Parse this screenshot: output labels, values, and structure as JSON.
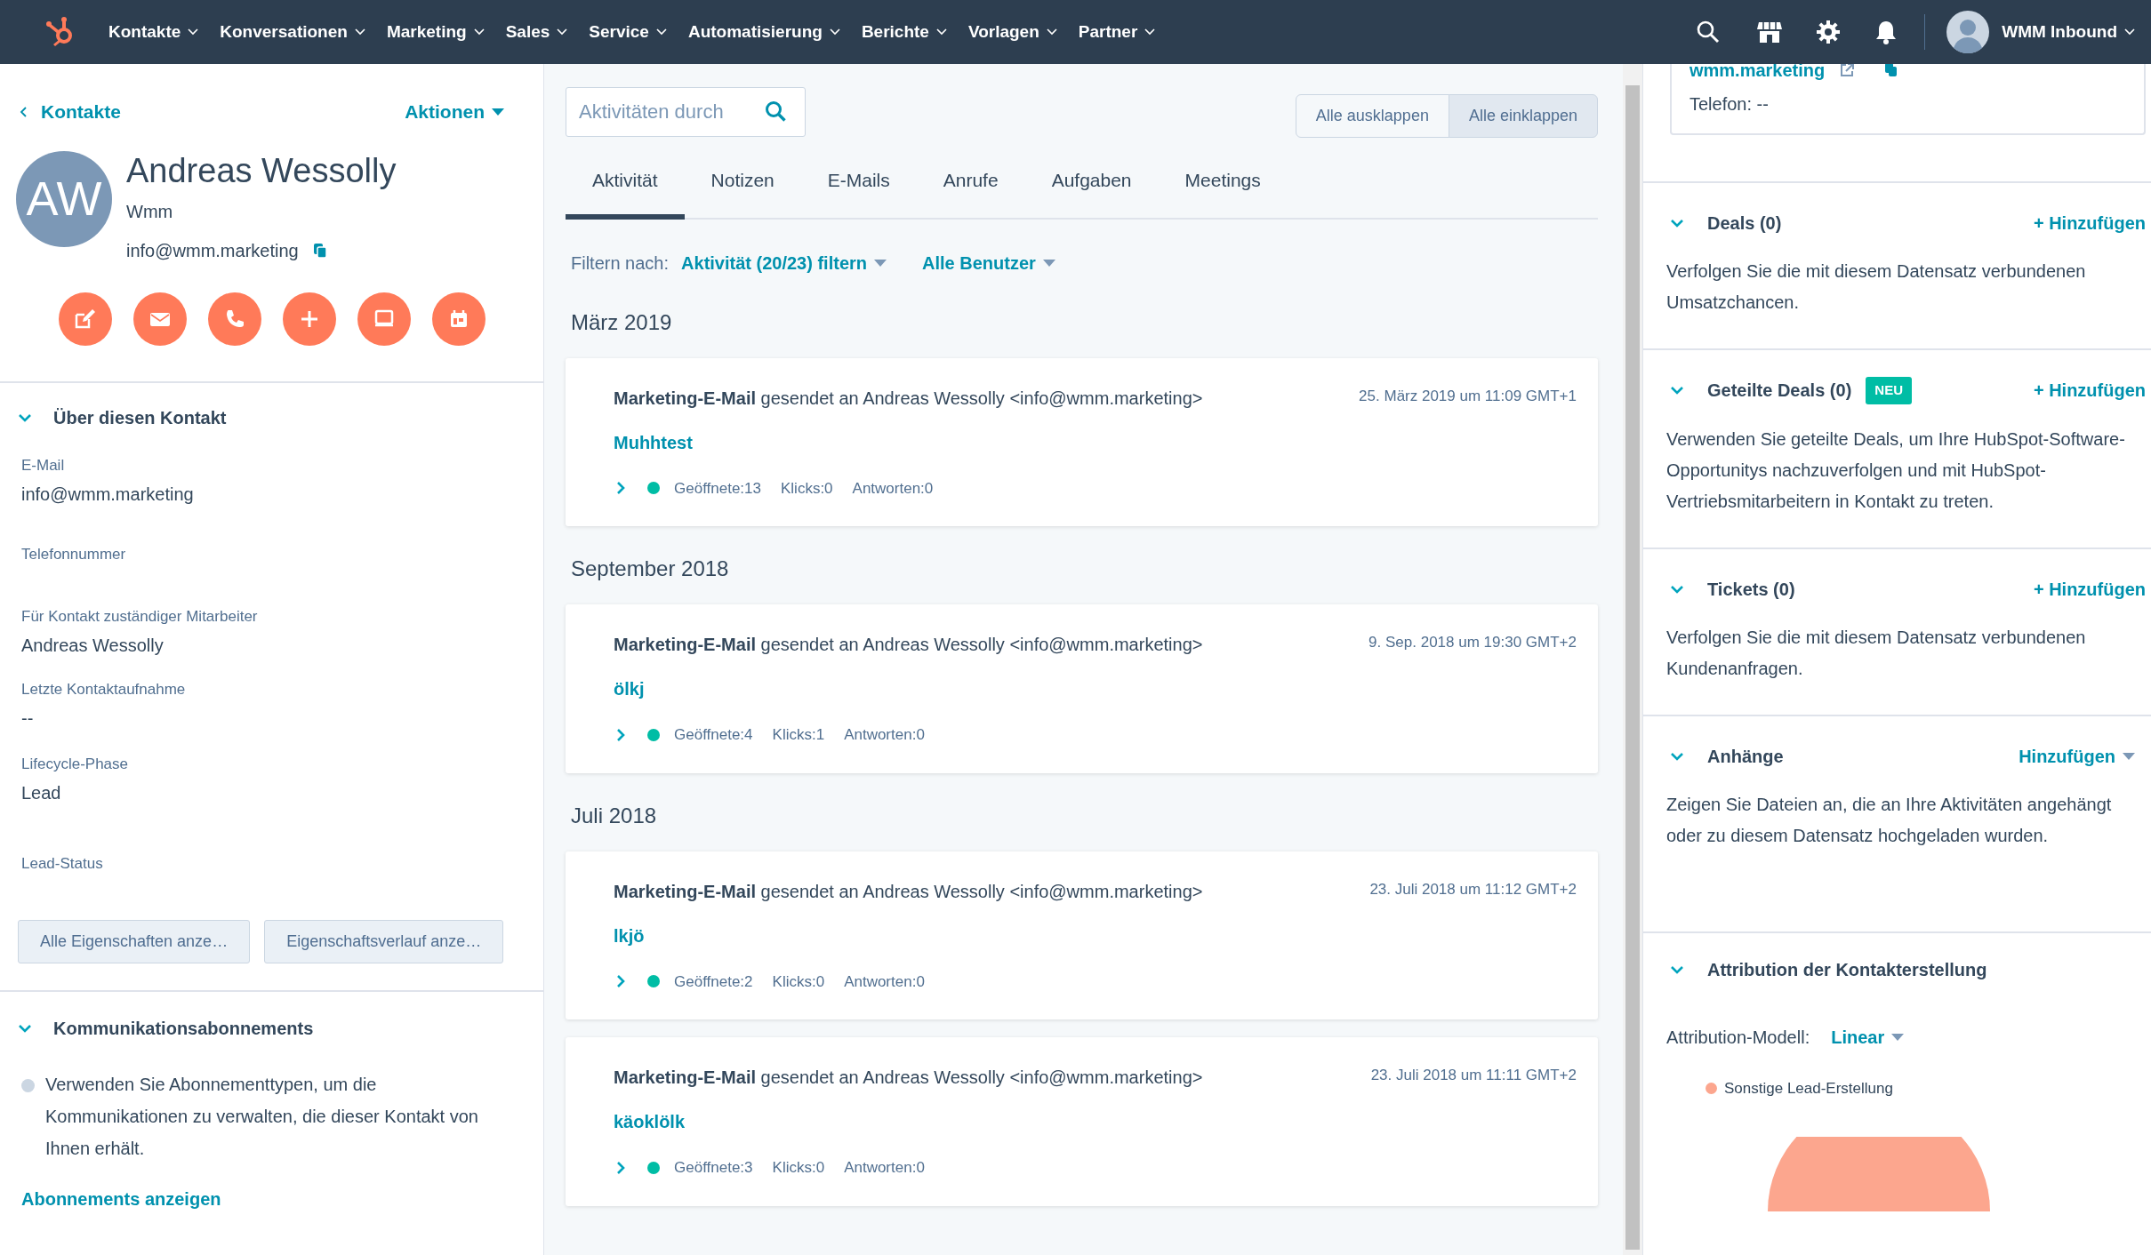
{
  "nav": {
    "items": [
      {
        "label": "Kontakte"
      },
      {
        "label": "Konversationen"
      },
      {
        "label": "Marketing"
      },
      {
        "label": "Sales"
      },
      {
        "label": "Service"
      },
      {
        "label": "Automatisierung"
      },
      {
        "label": "Berichte"
      },
      {
        "label": "Vorlagen"
      },
      {
        "label": "Partner"
      }
    ],
    "account": "WMM Inbound"
  },
  "contact": {
    "back": "Kontakte",
    "actions": "Aktionen",
    "initials": "AW",
    "name": "Andreas Wessolly",
    "company": "Wmm",
    "email": "info@wmm.marketing"
  },
  "about": {
    "title": "Über diesen Kontakt",
    "expanded": true,
    "fields": [
      {
        "label": "E-Mail",
        "value": "info@wmm.marketing"
      },
      {
        "label": "Telefonnummer"
      },
      {
        "label": "Für Kontakt zuständiger Mitarbeiter",
        "value": "Andreas Wessolly"
      },
      {
        "label": "Letzte Kontaktaufnahme",
        "value": "--"
      },
      {
        "label": "Lifecycle-Phase",
        "value": "Lead"
      },
      {
        "label": "Lead-Status"
      }
    ],
    "buttons": [
      "Alle Eigenschaften anze…",
      "Eigenschaftsverlauf anze…"
    ]
  },
  "subscriptions": {
    "title": "Kommunikationsabonnements",
    "expanded": true,
    "text": "Verwenden Sie Abonnementtypen, um die Kommunikationen zu verwalten, die dieser Kontakt von Ihnen erhält.",
    "link": "Abonnements anzeigen"
  },
  "activity": {
    "search": {
      "placeholder": "Aktivitäten durch"
    },
    "toggles": [
      {
        "label": "Alle ausklappen",
        "selected": false
      },
      {
        "label": "Alle einklappen",
        "selected": true
      }
    ],
    "tabs": [
      {
        "label": "Aktivität",
        "selected": true
      },
      {
        "label": "Notizen",
        "selected": false
      },
      {
        "label": "E-Mails",
        "selected": false
      },
      {
        "label": "Anrufe",
        "selected": false
      },
      {
        "label": "Aufgaben",
        "selected": false
      },
      {
        "label": "Meetings",
        "selected": false
      }
    ],
    "filter_label": "Filtern nach:",
    "filters": [
      "Aktivität (20/23) filtern",
      "Alle Benutzer"
    ],
    "groups": [
      {
        "month": "März 2019",
        "items": [
          {
            "summary": "**Marketing-E-Mail** gesendet an Andreas Wessolly <info@wmm.marketing>",
            "date": "25. März 2019 um 11:09 GMT+1",
            "subject": "Muhhtest",
            "expanded": false,
            "stats": [
              "Geöffnete:13",
              "Klicks:0",
              "Antworten:0"
            ]
          }
        ]
      },
      {
        "month": "September 2018",
        "items": [
          {
            "summary": "**Marketing-E-Mail** gesendet an Andreas Wessolly <info@wmm.marketing>",
            "date": "9. Sep. 2018 um 19:30 GMT+2",
            "subject": "ölkj",
            "expanded": false,
            "stats": [
              "Geöffnete:4",
              "Klicks:1",
              "Antworten:0"
            ]
          }
        ]
      },
      {
        "month": "Juli 2018",
        "items": [
          {
            "summary": "**Marketing-E-Mail** gesendet an Andreas Wessolly <info@wmm.marketing>",
            "date": "23. Juli 2018 um 11:12 GMT+2",
            "subject": "lkjö",
            "expanded": false,
            "stats": [
              "Geöffnete:2",
              "Klicks:0",
              "Antworten:0"
            ]
          },
          {
            "summary": "**Marketing-E-Mail** gesendet an Andreas Wessolly <info@wmm.marketing>",
            "date": "23. Juli 2018 um 11:11 GMT+2",
            "subject": "käoklölk",
            "expanded": false,
            "stats": [
              "Geöffnete:3",
              "Klicks:0",
              "Antworten:0"
            ]
          }
        ]
      }
    ]
  },
  "company_card": {
    "link": "wmm.marketing",
    "phone": "Telefon: --"
  },
  "sections": [
    {
      "kind": "add",
      "title": "Deals (0)",
      "expanded": true,
      "action": "+ Hinzufügen",
      "text": "Verfolgen Sie die mit diesem Datensatz verbundenen Umsatzchancen."
    },
    {
      "kind": "add",
      "title": "Geteilte Deals (0)",
      "badge": "NEU",
      "expanded": true,
      "action": "+ Hinzufügen",
      "text": "Verwenden Sie geteilte Deals, um Ihre HubSpot-Software-Opportunitys nachzuverfolgen und mit HubSpot-Vertriebsmitarbeitern in Kontakt zu treten."
    },
    {
      "kind": "add",
      "title": "Tickets (0)",
      "expanded": true,
      "action": "+ Hinzufügen",
      "text": "Verfolgen Sie die mit diesem Datensatz verbundenen Kundenanfragen."
    },
    {
      "kind": "dropdown",
      "title": "Anhänge",
      "expanded": true,
      "action": "Hinzufügen",
      "text": "Zeigen Sie Dateien an, die an Ihre Aktivitäten angehängt oder zu diesem Datensatz hochgeladen wurden."
    }
  ],
  "attribution": {
    "title": "Attribution der Kontakterstellung",
    "expanded": true,
    "model_label": "Attribution-Modell:",
    "model": "Linear",
    "legend": [
      {
        "label": "Sonstige Lead-Erstellung",
        "color": "#fca68e"
      }
    ]
  }
}
